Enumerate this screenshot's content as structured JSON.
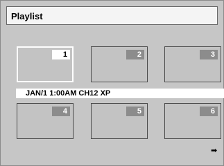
{
  "title": "Playlist",
  "thumbnails": [
    {
      "number": "1"
    },
    {
      "number": "2"
    },
    {
      "number": "3"
    },
    {
      "number": "4"
    },
    {
      "number": "5"
    },
    {
      "number": "6"
    }
  ],
  "info": "JAN/1 1:00AM CH12 XP",
  "next_icon": "➡"
}
